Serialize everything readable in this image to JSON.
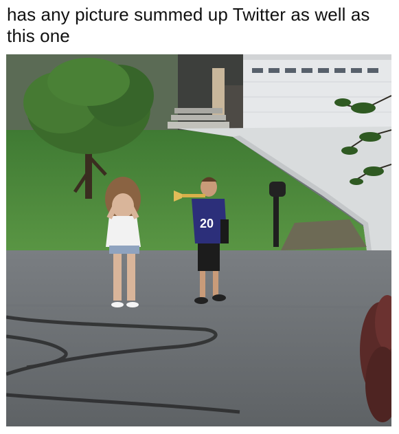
{
  "post": {
    "caption": "has any picture summed up Twitter as well as this one"
  },
  "photo": {
    "jersey_number": "20",
    "description_icons": [
      "girl-covering-ears",
      "boy-playing-trumpet",
      "mailbox",
      "house-garage",
      "tree"
    ]
  },
  "colors": {
    "lawn": "#4c8a3c",
    "road": "#676b6f",
    "jersey": "#2c2f7a",
    "garage": "#e9ebee",
    "trumpet": "#d8b04a"
  }
}
